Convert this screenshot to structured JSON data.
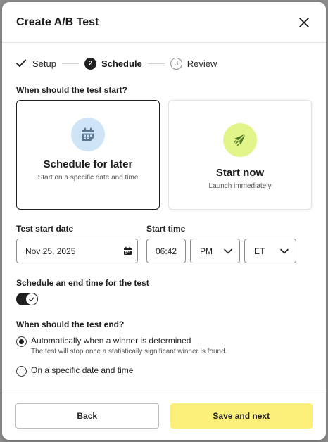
{
  "modal": {
    "title": "Create A/B Test"
  },
  "stepper": {
    "steps": [
      {
        "number": "",
        "label": "Setup",
        "state": "complete"
      },
      {
        "number": "2",
        "label": "Schedule",
        "state": "active"
      },
      {
        "number": "3",
        "label": "Review",
        "state": "upcoming"
      }
    ]
  },
  "start": {
    "question": "When should the test start?",
    "options": [
      {
        "title": "Schedule for later",
        "description": "Start on a specific date and time",
        "icon": "calendar-icon",
        "selected": true
      },
      {
        "title": "Start now",
        "description": "Launch immediately",
        "icon": "paper-plane-icon",
        "selected": false
      }
    ]
  },
  "datetime": {
    "date_label": "Test start date",
    "date_value": "Nov 25, 2025",
    "time_label": "Start time",
    "time_value": "06:42",
    "ampm_value": "PM",
    "timezone_value": "ET"
  },
  "end_toggle": {
    "label": "Schedule an end time for the test",
    "checked": true
  },
  "end": {
    "question": "When should the test end?",
    "options": [
      {
        "label": "Automatically when a winner is determined",
        "help": "The test will stop once a statistically significant winner is found.",
        "selected": true
      },
      {
        "label": "On a specific date and time",
        "help": "",
        "selected": false
      }
    ]
  },
  "footer": {
    "back_label": "Back",
    "next_label": "Save and next"
  },
  "colors": {
    "primary_button": "#fdf07a",
    "schedule_icon_bg": "#cfe4f7",
    "start_now_icon_bg": "#e2f58a",
    "dark": "#1f1f1f"
  }
}
